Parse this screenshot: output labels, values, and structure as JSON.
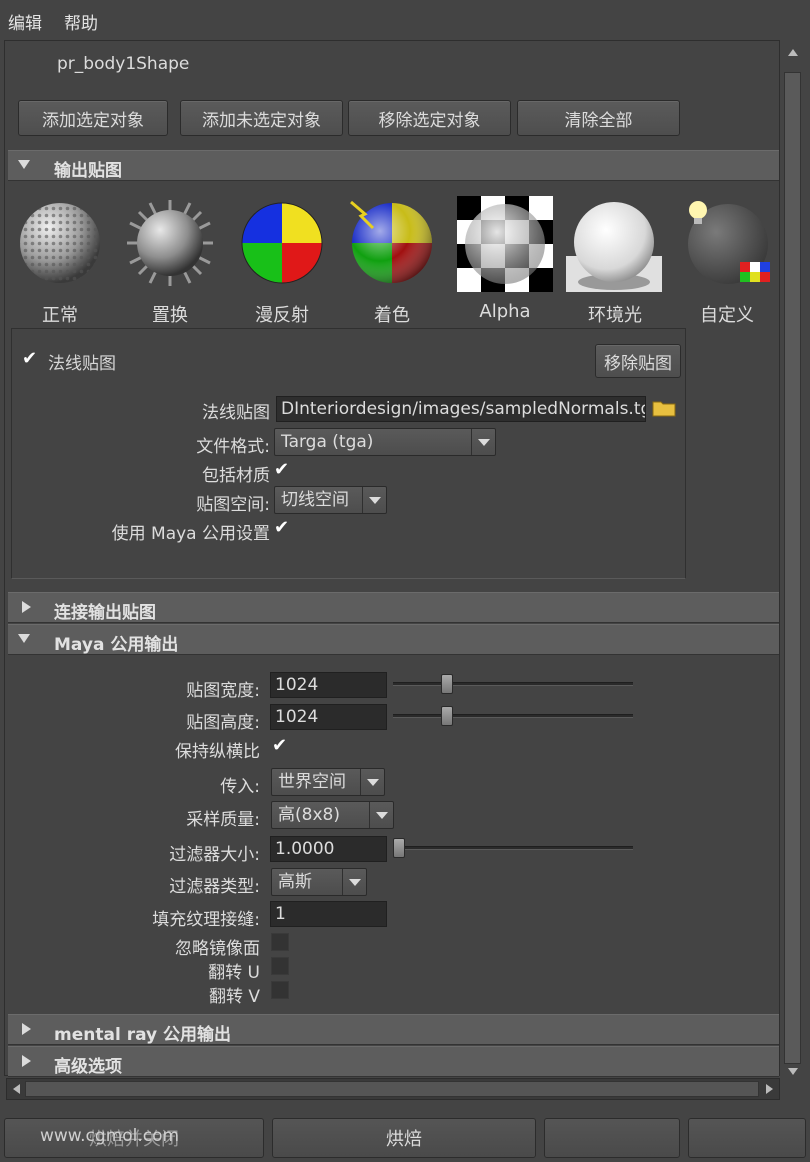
{
  "menu": {
    "edit": "编辑",
    "help": "帮助"
  },
  "shape_name": "pr_body1Shape",
  "top_buttons": {
    "add_selected": "添加选定对象",
    "add_unselected": "添加未选定对象",
    "remove_selected": "移除选定对象",
    "clear_all": "清除全部"
  },
  "output_maps": {
    "title": "输出贴图",
    "maps": [
      {
        "label": "正常",
        "icon": "normal-sphere-icon"
      },
      {
        "label": "置换",
        "icon": "displacement-sphere-icon"
      },
      {
        "label": "漫反射",
        "icon": "diffuse-sphere-icon"
      },
      {
        "label": "着色",
        "icon": "shaded-sphere-icon"
      },
      {
        "label": "Alpha",
        "icon": "alpha-sphere-icon"
      },
      {
        "label": "环境光",
        "icon": "ambient-occlusion-sphere-icon"
      },
      {
        "label": "自定义",
        "icon": "custom-sphere-icon"
      }
    ],
    "normal_map": {
      "checkbox_label": "法线贴图",
      "checked": true,
      "remove_button": "移除贴图",
      "file_label": "法线贴图",
      "file_value": "DInteriordesign/images/sampledNormals.tga",
      "format_label": "文件格式:",
      "format_value": "Targa (tga)",
      "include_material_label": "包括材质",
      "include_material_checked": true,
      "map_space_label": "贴图空间:",
      "map_space_value": "切线空间",
      "use_maya_label": "使用 Maya 公用设置",
      "use_maya_checked": true
    }
  },
  "connect_output": {
    "title": "连接输出贴图"
  },
  "maya_common": {
    "title": "Maya 公用输出",
    "width_label": "贴图宽度:",
    "width_value": "1024",
    "width_slider_fraction": 0.21,
    "height_label": "贴图高度:",
    "height_value": "1024",
    "height_slider_fraction": 0.21,
    "keep_aspect_label": "保持纵横比",
    "keep_aspect_checked": true,
    "transfer_in_label": "传入:",
    "transfer_in_value": "世界空间",
    "sampling_label": "采样质量:",
    "sampling_value": "高(8x8)",
    "filter_size_label": "过滤器大小:",
    "filter_size_value": "1.0000",
    "filter_size_slider_fraction": 0.0,
    "filter_type_label": "过滤器类型:",
    "filter_type_value": "高斯",
    "fill_seams_label": "填充纹理接缝:",
    "fill_seams_value": "1",
    "ignore_mirror_label": "忽略镜像面",
    "flip_u_label": "翻转 U",
    "flip_v_label": "翻转 V"
  },
  "mental_ray": {
    "title": "mental ray 公用输出"
  },
  "advanced": {
    "title": "高级选项"
  },
  "bottom": {
    "watermark": "www.cgmol.com",
    "close_label": "烘焙并关闭",
    "bake_label": "烘焙"
  }
}
